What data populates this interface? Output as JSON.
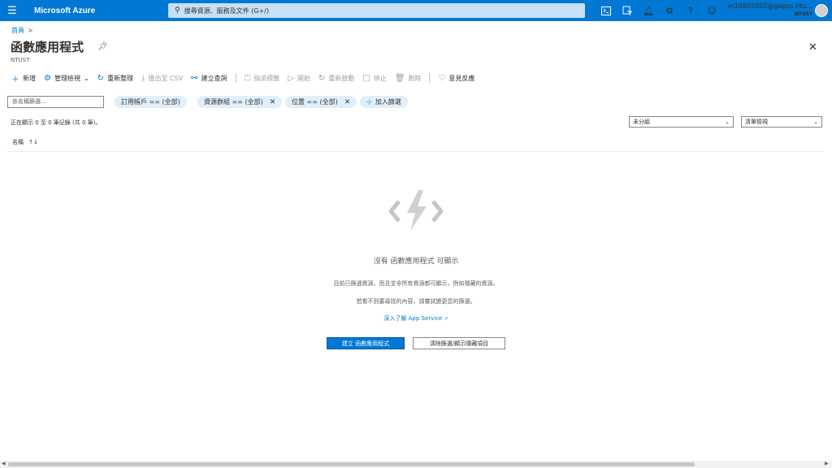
{
  "header": {
    "brand": "Microsoft Azure",
    "search_placeholder": "搜尋資源、服務及文件 (G+/)",
    "account_name": "m10805502@gapps.ntu...",
    "account_tenant": "NTUST",
    "icons": [
      "cloud-shell-icon",
      "directory-filter-icon",
      "notifications-icon",
      "settings-icon",
      "help-icon",
      "feedback-smiley-icon"
    ]
  },
  "breadcrumb": {
    "home": "首頁",
    "separator": ">"
  },
  "page": {
    "title": "函數應用程式",
    "subtitle": "NTUST"
  },
  "toolbar": {
    "new": "新增",
    "manage_view": "管理檢視",
    "refresh": "重新整理",
    "export_csv": "匯出至 CSV",
    "open_query": "建立查詢",
    "assign_tags": "指派標籤",
    "start": "開始",
    "restart": "重新啟動",
    "stop": "停止",
    "delete": "刪除",
    "feedback": "意見反應"
  },
  "filters": {
    "name_placeholder": "依名稱篩選...",
    "subscription": "訂用帳戶 == (全部)",
    "resource_group": "資源群組 == (全部)",
    "location": "位置 == (全部)",
    "add_filter": "加入篩選"
  },
  "status_text": "正在顯示 0 至 0 筆記錄 (共 0 筆)。",
  "grouping": {
    "value": "未分組"
  },
  "view": {
    "value": "清單檢視"
  },
  "table": {
    "columns": [
      {
        "label": "名稱",
        "sort": "↑↓"
      }
    ]
  },
  "empty_state": {
    "title": "沒有 函數應用程式 可顯示",
    "line1": "目前已篩選資源，而且並非所有資源都可顯示，例如隱藏的資源。",
    "line2": "若看不到要尋找的內容，請嘗試變更您的篩選。",
    "learn_more": "深入了解 App Service",
    "create_button": "建立 函數應用程式",
    "clear_button": "清除篩選/顯示隱藏項目"
  },
  "colors": {
    "accent": "#0078d4",
    "pill": "#e1effa"
  }
}
